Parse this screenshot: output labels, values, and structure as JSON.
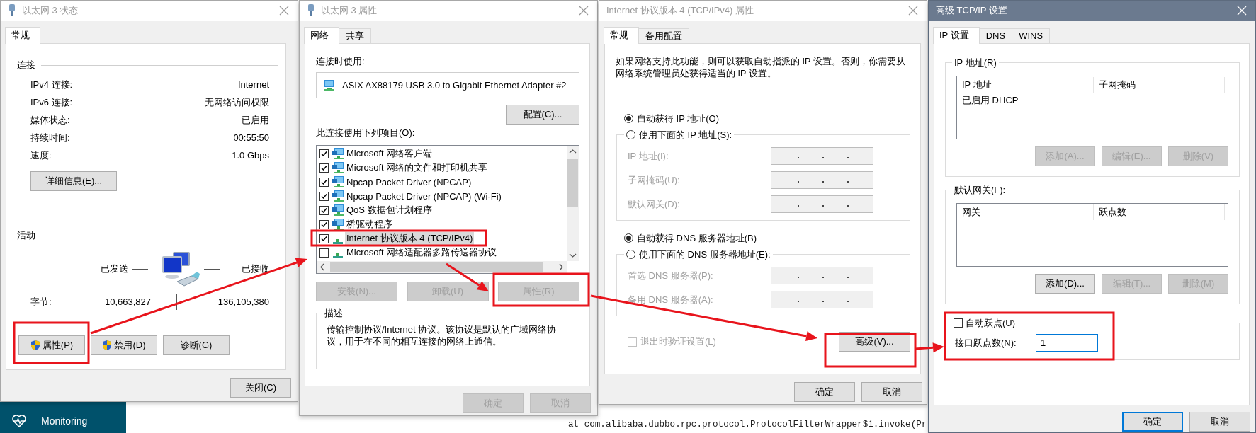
{
  "desktop": {
    "sidebar_item": "Monitoring",
    "log_line": "at com.alibaba.dubbo.rpc.protocol.ProtocolFilterWrapper$1.invoke(Pr"
  },
  "status_dialog": {
    "title": "以太网 3 状态",
    "active": false,
    "tabs": [
      {
        "label": "常规",
        "selected": true
      }
    ],
    "connection_heading": "连接",
    "connection_rows": [
      {
        "label": "IPv4 连接:",
        "value": "Internet"
      },
      {
        "label": "IPv6 连接:",
        "value": "无网络访问权限"
      },
      {
        "label": "媒体状态:",
        "value": "已启用"
      },
      {
        "label": "持续时间:",
        "value": "00:55:50"
      },
      {
        "label": "速度:",
        "value": "1.0 Gbps"
      }
    ],
    "details_button": "详细信息(E)...",
    "activity_heading": "活动",
    "sent_label": "已发送",
    "received_label": "已接收",
    "bytes_label": "字节:",
    "bytes_sent": "10,663,827",
    "bytes_received": "136,105,380",
    "buttons": [
      {
        "label": "属性(P)",
        "shield": true
      },
      {
        "label": "禁用(D)",
        "shield": true
      },
      {
        "label": "诊断(G)",
        "shield": false
      }
    ],
    "close_button": "关闭(C)"
  },
  "properties_dialog": {
    "title": "以太网 3 属性",
    "active": false,
    "tabs": [
      {
        "label": "网络",
        "selected": true
      },
      {
        "label": "共享",
        "selected": false
      }
    ],
    "connect_using_label": "连接时使用:",
    "adapter": "ASIX AX88179 USB 3.0 to Gigabit Ethernet Adapter #2",
    "configure_button": "配置(C)...",
    "items_label": "此连接使用下列项目(O):",
    "items": [
      {
        "label": "Microsoft 网络客户端",
        "kind": "service",
        "checked": true,
        "selected": false
      },
      {
        "label": "Microsoft 网络的文件和打印机共享",
        "kind": "service",
        "checked": true,
        "selected": false
      },
      {
        "label": "Npcap Packet Driver (NPCAP)",
        "kind": "service",
        "checked": true,
        "selected": false
      },
      {
        "label": "Npcap Packet Driver (NPCAP) (Wi-Fi)",
        "kind": "service",
        "checked": true,
        "selected": false
      },
      {
        "label": "QoS 数据包计划程序",
        "kind": "service",
        "checked": true,
        "selected": false
      },
      {
        "label": "桥驱动程序",
        "kind": "service",
        "checked": true,
        "selected": false
      },
      {
        "label": "Internet 协议版本 4 (TCP/IPv4)",
        "kind": "protocol",
        "checked": true,
        "selected": true
      },
      {
        "label": "Microsoft 网络适配器多路传送器协议",
        "kind": "protocol",
        "checked": false,
        "selected": false
      }
    ],
    "action_buttons": [
      {
        "label": "安装(N)...",
        "disabled": true
      },
      {
        "label": "卸载(U)",
        "disabled": true
      },
      {
        "label": "属性(R)",
        "disabled": true
      }
    ],
    "description_heading": "描述",
    "description": "传输控制协议/Internet 协议。该协议是默认的广域网络协议，用于在不同的相互连接的网络上通信。",
    "footer_buttons": [
      {
        "label": "确定",
        "disabled": true
      },
      {
        "label": "取消",
        "disabled": true
      }
    ]
  },
  "ipv4_dialog": {
    "title": "Internet 协议版本 4 (TCP/IPv4) 属性",
    "active": false,
    "tabs": [
      {
        "label": "常规",
        "selected": true
      },
      {
        "label": "备用配置",
        "selected": false
      }
    ],
    "intro": "如果网络支持此功能，则可以获取自动指派的 IP 设置。否则，你需要从网络系统管理员处获得适当的 IP 设置。",
    "ip_options": [
      {
        "label": "自动获得 IP 地址(O)",
        "selected": true
      },
      {
        "label": "使用下面的 IP 地址(S):",
        "selected": false
      }
    ],
    "ip_fields": [
      {
        "label": "IP 地址(I):",
        "disabled": true
      },
      {
        "label": "子网掩码(U):",
        "disabled": true
      },
      {
        "label": "默认网关(D):",
        "disabled": true
      }
    ],
    "dns_options": [
      {
        "label": "自动获得 DNS 服务器地址(B)",
        "selected": true
      },
      {
        "label": "使用下面的 DNS 服务器地址(E):",
        "selected": false
      }
    ],
    "dns_fields": [
      {
        "label": "首选 DNS 服务器(P):",
        "disabled": true
      },
      {
        "label": "备用 DNS 服务器(A):",
        "disabled": true
      }
    ],
    "validate_checkbox": {
      "label": "退出时验证设置(L)",
      "checked": false,
      "disabled": true
    },
    "advanced_button": "高级(V)...",
    "footer_buttons": [
      {
        "label": "确定",
        "disabled": false
      },
      {
        "label": "取消",
        "disabled": false
      }
    ]
  },
  "advanced_dialog": {
    "title": "高级 TCP/IP 设置",
    "active": true,
    "tabs": [
      {
        "label": "IP 设置",
        "selected": true
      },
      {
        "label": "DNS",
        "selected": false
      },
      {
        "label": "WINS",
        "selected": false
      }
    ],
    "ip_group": {
      "title": "IP 地址(R)",
      "columns": [
        "IP 地址",
        "子网掩码"
      ],
      "rows": [
        [
          "已启用 DHCP"
        ]
      ],
      "buttons": [
        {
          "label": "添加(A)...",
          "disabled": true
        },
        {
          "label": "编辑(E)...",
          "disabled": true
        },
        {
          "label": "删除(V)",
          "disabled": true
        }
      ]
    },
    "gateway_group": {
      "title": "默认网关(F):",
      "columns": [
        "网关",
        "跃点数"
      ],
      "buttons": [
        {
          "label": "添加(D)...",
          "disabled": false
        },
        {
          "label": "编辑(T)...",
          "disabled": true
        },
        {
          "label": "删除(M)",
          "disabled": true
        }
      ]
    },
    "auto_metric": {
      "label": "自动跃点(U)",
      "checked": false
    },
    "metric_label": "接口跃点数(N):",
    "metric_value": "1",
    "footer_buttons": [
      {
        "label": "确定",
        "default": true
      },
      {
        "label": "取消",
        "default": false
      }
    ]
  }
}
